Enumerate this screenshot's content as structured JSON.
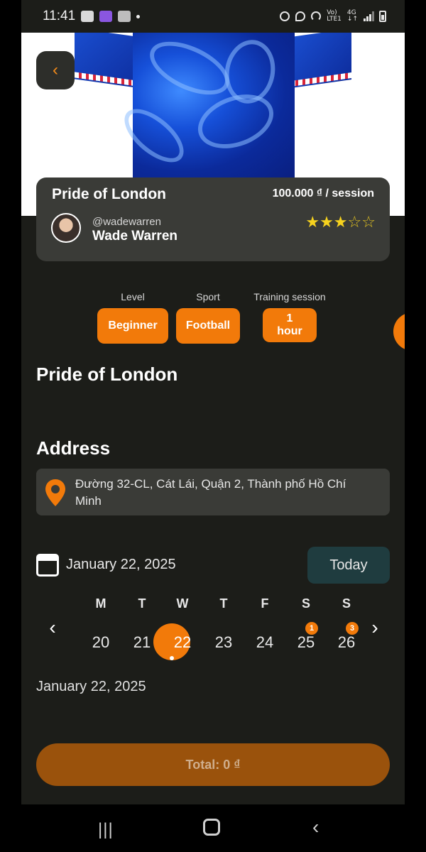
{
  "status_bar": {
    "time": "11:41",
    "network_label": "Vo) 4G\nLTE1"
  },
  "hero": {
    "back_icon": "chevron-left-icon"
  },
  "card": {
    "title": "Pride of London",
    "price": "100.000 ₫ / session",
    "coach_handle": "@wadewarren",
    "coach_name": "Wade Warren",
    "rating": 3,
    "rating_max": 5
  },
  "chips": [
    {
      "label": "Level",
      "value": "Beginner"
    },
    {
      "label": "Sport",
      "value": "Football"
    },
    {
      "label": "Training session",
      "value": "1 hour"
    }
  ],
  "description_title": "Pride of London",
  "address": {
    "heading": "Address",
    "text": "Đường 32-CL, Cát Lái, Quận 2, Thành phố Hồ Chí Minh"
  },
  "calendar": {
    "current_date": "January 22, 2025",
    "today_label": "Today",
    "weekdays": [
      "M",
      "T",
      "W",
      "T",
      "F",
      "S",
      "S"
    ],
    "days": [
      "20",
      "21",
      "22",
      "23",
      "24",
      "25",
      "26"
    ],
    "selected_day": "22",
    "badges": {
      "25": "1",
      "26": "3"
    },
    "prev_icon": "chevron-left-icon",
    "next_icon": "chevron-right-icon",
    "selected_date_text": "January 22, 2025"
  },
  "total": {
    "label": "Total: 0 ₫"
  },
  "colors": {
    "accent": "#f27a0a",
    "background": "#1c1d19",
    "card": "#3a3b37"
  }
}
